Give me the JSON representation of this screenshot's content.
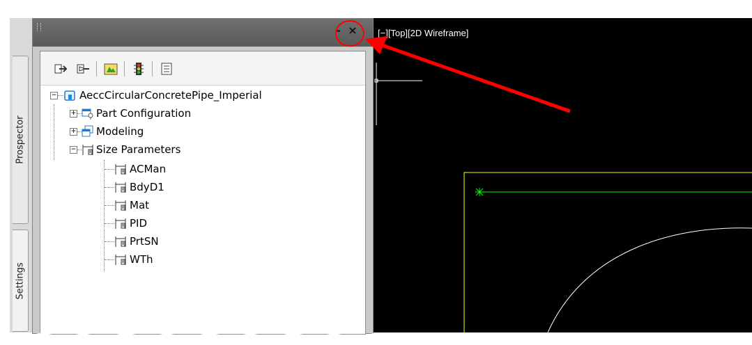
{
  "panel": {
    "side_tabs": [
      "Prospector",
      "Settings"
    ],
    "titlebar_controls": {
      "minimize": "–",
      "close": "×"
    }
  },
  "toolbar": {
    "buttons": [
      "import-icon",
      "export-icon",
      "part-catalog-icon",
      "traffic-light-icon",
      "list-icon"
    ]
  },
  "tree": {
    "root": {
      "label": "AeccCircularConcretePipe_Imperial",
      "icon": "part-icon",
      "expanded": true
    },
    "children": [
      {
        "label": "Part Configuration",
        "icon": "configuration-icon",
        "expanded": false
      },
      {
        "label": "Modeling",
        "icon": "modeling-icon",
        "expanded": false
      },
      {
        "label": "Size Parameters",
        "icon": "parameter-icon",
        "expanded": true,
        "items": [
          "ACMan",
          "BdyD1",
          "Mat",
          "PID",
          "PrtSN",
          "WTh"
        ]
      }
    ]
  },
  "viewport": {
    "label": "[−][Top][2D Wireframe]",
    "background": "#000000",
    "colors": {
      "yellow_line": "#ffff00",
      "green_line": "#00ff00",
      "arc": "#ffffff",
      "annotation": "#ff0000"
    }
  }
}
